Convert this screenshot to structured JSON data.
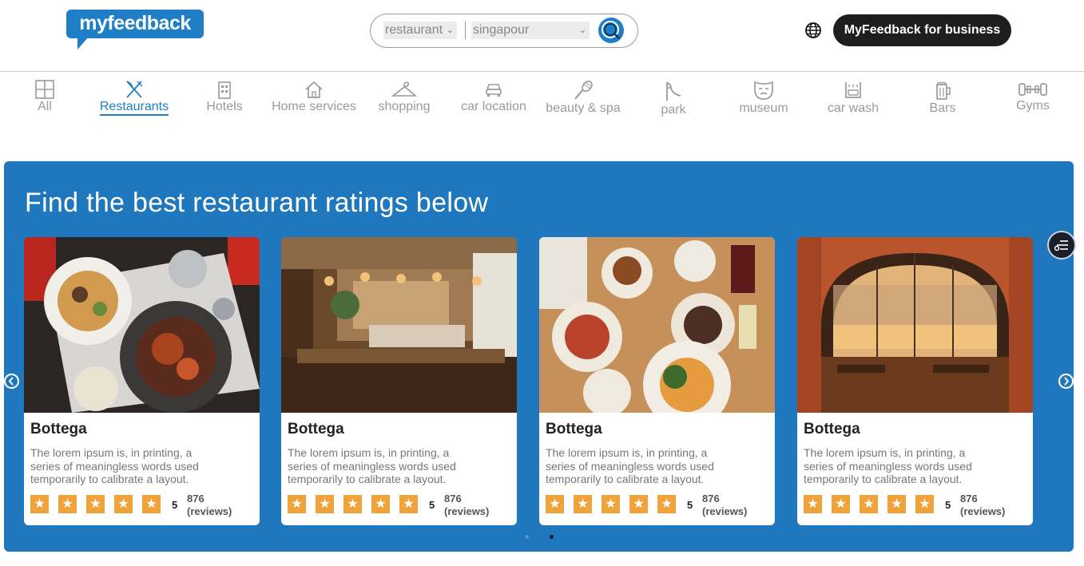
{
  "brand": {
    "logo_text": "myfeedback",
    "color": "#1e7fc7"
  },
  "header": {
    "search": {
      "category_value": "restaurant",
      "location_value": "singapour",
      "search_icon": "search-icon"
    },
    "language_icon": "globe-icon",
    "business_button": "MyFeedback for business"
  },
  "categories": [
    {
      "label": "All",
      "icon": "grid-icon",
      "active": false
    },
    {
      "label": "Restaurants",
      "icon": "fork-knife-icon",
      "active": true
    },
    {
      "label": "Hotels",
      "icon": "building-icon",
      "active": false
    },
    {
      "label": "Home services",
      "icon": "house-icon",
      "active": false
    },
    {
      "label": "shopping",
      "icon": "hanger-icon",
      "active": false
    },
    {
      "label": "car location",
      "icon": "car-icon",
      "active": false
    },
    {
      "label": "beauty & spa",
      "icon": "spa-icon",
      "active": false
    },
    {
      "label": "park",
      "icon": "slide-icon",
      "active": false
    },
    {
      "label": "museum",
      "icon": "mask-icon",
      "active": false
    },
    {
      "label": "car wash",
      "icon": "car-wash-icon",
      "active": false
    },
    {
      "label": "Bars",
      "icon": "beer-icon",
      "active": false
    },
    {
      "label": "Gyms",
      "icon": "dumbbell-icon",
      "active": false
    }
  ],
  "hero": {
    "title": "Find the best restaurant ratings below",
    "background": "#1f77bd",
    "cards": [
      {
        "name": "Bottega",
        "description": "The lorem ipsum is, in printing, a series of meaningless words used temporarily to calibrate a layout.",
        "stars": 5,
        "rating": "5",
        "reviews_count": "876",
        "reviews_label": "(reviews)",
        "image": "plated-dishes-photo"
      },
      {
        "name": "Bottega",
        "description": "The lorem ipsum is, in printing, a series of meaningless words used temporarily to calibrate a layout.",
        "stars": 5,
        "rating": "5",
        "reviews_count": "876",
        "reviews_label": "(reviews)",
        "image": "restaurant-interior-photo"
      },
      {
        "name": "Bottega",
        "description": "The lorem ipsum is, in printing, a series of meaningless words used temporarily to calibrate a layout.",
        "stars": 5,
        "rating": "5",
        "reviews_count": "876",
        "reviews_label": "(reviews)",
        "image": "table-food-photo"
      },
      {
        "name": "Bottega",
        "description": "The lorem ipsum is, in printing, a series of meaningless words used temporarily to calibrate a layout.",
        "stars": 5,
        "rating": "5",
        "reviews_count": "876",
        "reviews_label": "(reviews)",
        "image": "arched-window-dining-photo"
      }
    ],
    "carousel": {
      "pages": 2,
      "current": 2
    }
  },
  "colors": {
    "star": "#f0a33a",
    "active_category": "#1e7fc7",
    "business_button": "#1e1e1e"
  }
}
